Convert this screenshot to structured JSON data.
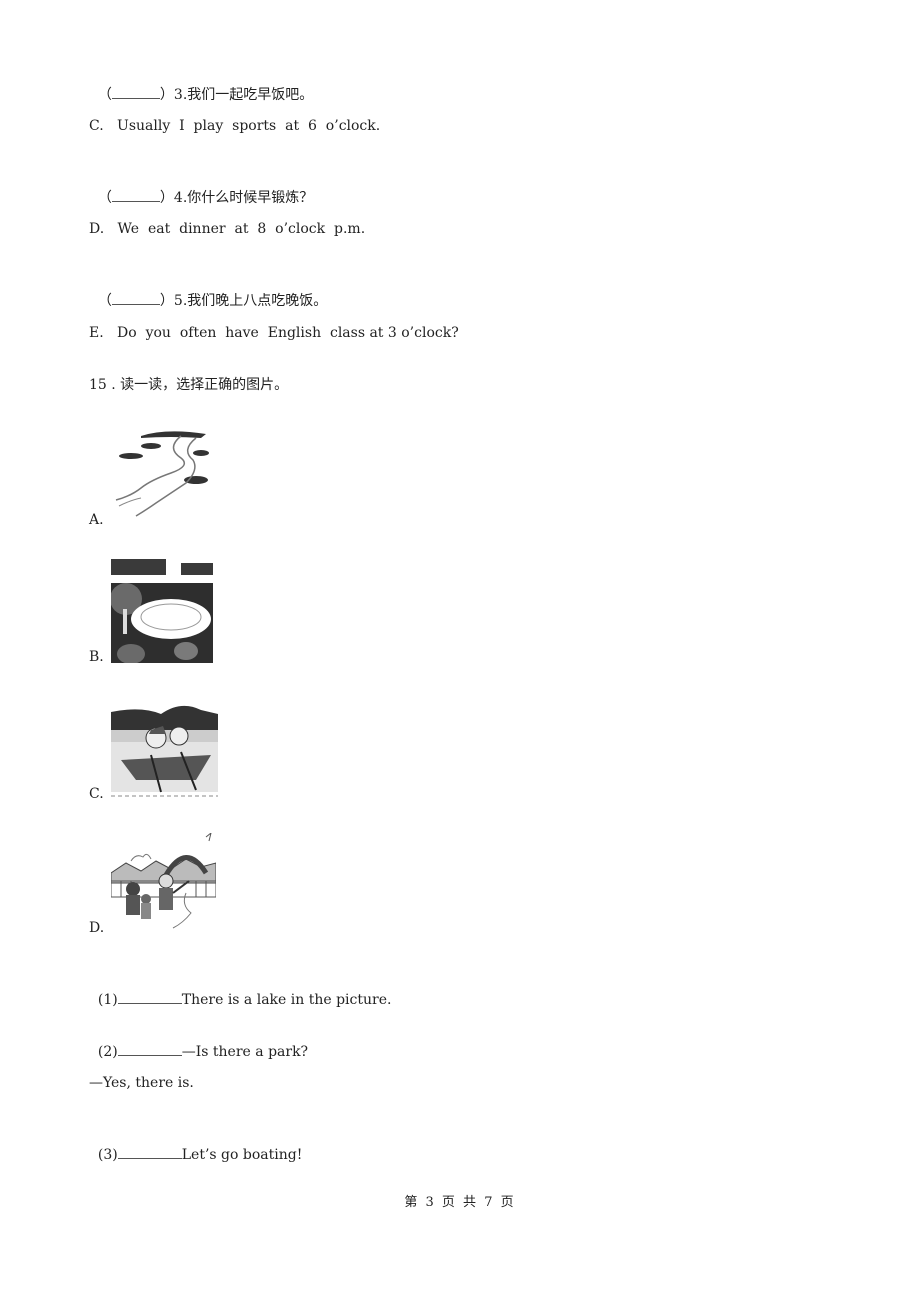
{
  "matching": {
    "items": [
      {
        "kind": "question",
        "prefix": "（",
        "suffix": "）3.我们一起吃早饭吧。"
      },
      {
        "kind": "option",
        "text": "C.   Usually  I  play  sports  at  6  o’clock."
      },
      {
        "kind": "question",
        "prefix": "（",
        "suffix": "）4.你什么时候早锻炼？"
      },
      {
        "kind": "option",
        "text": "D.   We  eat  dinner  at  8  o’clock  p.m."
      },
      {
        "kind": "question",
        "prefix": "（",
        "suffix": "）5.我们晚上八点吃晚饭。"
      },
      {
        "kind": "option",
        "text": "E.   Do  you  often  have  English  class at 3 o’clock?"
      }
    ]
  },
  "question15": {
    "title": "15 . 读一读，选择正确的图片。",
    "options": [
      {
        "label": "A.",
        "image": "river-landscape-picture"
      },
      {
        "label": "B.",
        "image": "lake-park-picture"
      },
      {
        "label": "C.",
        "image": "boating-children-picture"
      },
      {
        "label": "D.",
        "image": "park-family-picture"
      }
    ],
    "subquestions": [
      {
        "num": "(1)",
        "text": "There is a lake in the picture."
      },
      {
        "num": "(2)",
        "text": "—Is there a park?"
      },
      {
        "num": "",
        "text": "—Yes, there is."
      },
      {
        "num": "(3)",
        "text": "Let’s go boating!"
      }
    ]
  },
  "footer": {
    "page_label": "第 3 页 共 7 页"
  }
}
